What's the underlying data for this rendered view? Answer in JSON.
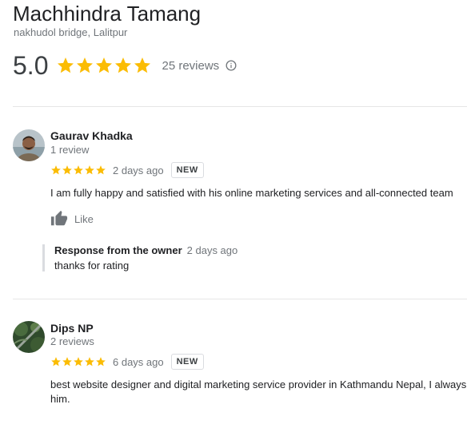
{
  "business": {
    "name": "Machhindra Tamang",
    "address": "nakhudol bridge, Lalitpur",
    "rating": "5.0",
    "reviews_count": "25 reviews",
    "star_color": "#fbbc04"
  },
  "reviews": [
    {
      "name": "Gaurav Khadka",
      "sub": "1 review",
      "date": "2 days ago",
      "badge": "NEW",
      "text": "I am fully happy and satisfied with his online marketing services and all-connected team",
      "like_label": "Like",
      "owner_response": {
        "label": "Response from the owner",
        "date": "2 days ago",
        "text": "thanks for rating"
      }
    },
    {
      "name": "Dips NP",
      "sub": "2 reviews",
      "date": "6 days ago",
      "badge": "NEW",
      "text": "best website designer and digital marketing service provider in Kathmandu Nepal, I always him."
    }
  ]
}
